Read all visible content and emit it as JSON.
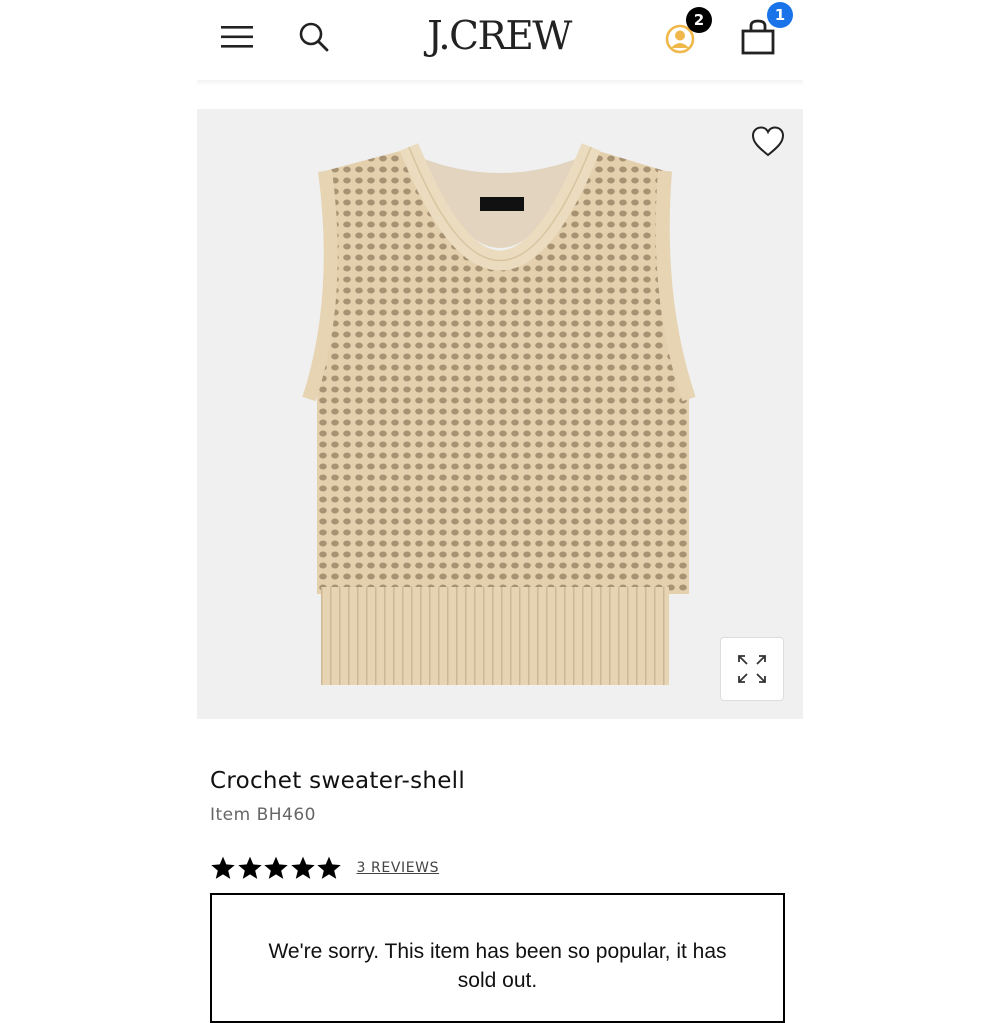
{
  "header": {
    "logo": "J.CREW",
    "account_badge": "2",
    "bag_badge": "1",
    "icons": [
      "hamburger-menu-icon",
      "search-icon",
      "account-icon",
      "shopping-bag-icon"
    ]
  },
  "product": {
    "image_alt": "Crochet sweater-shell",
    "title": "Crochet sweater-shell",
    "item_number": "Item BH460",
    "rating": 5,
    "reviews_label": "3 REVIEWS",
    "sold_out_message": "We're sorry. This item has been so popular, it has sold out."
  },
  "colors": {
    "badge_blue": "#1a73e8",
    "account_gold": "#f0b84a",
    "sweater_beige": "#e6d3b0"
  }
}
